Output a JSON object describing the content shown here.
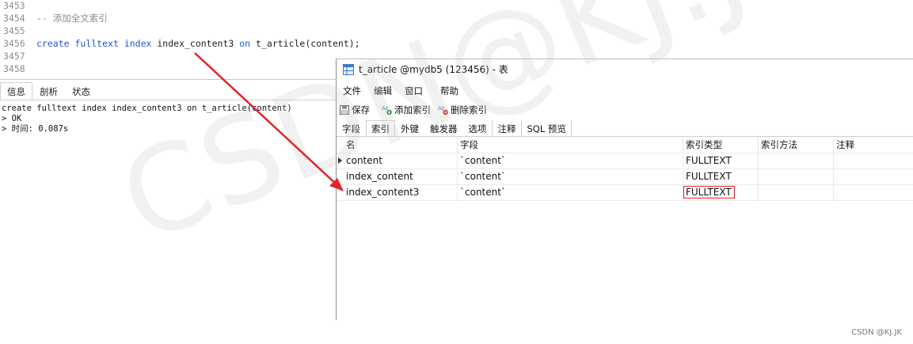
{
  "editor": {
    "lines": [
      {
        "num": "3453",
        "text": ""
      },
      {
        "num": "3454",
        "comment": "-- 添加全文索引"
      },
      {
        "num": "3455",
        "text": ""
      },
      {
        "num": "3456",
        "sql": true
      },
      {
        "num": "3457",
        "text": ""
      },
      {
        "num": "3458",
        "text": ""
      }
    ],
    "sql_tokens": {
      "create": "create",
      "fulltext": "fulltext",
      "index": "index",
      "name": "index_content3",
      "on": "on",
      "target": "t_article(content);"
    }
  },
  "result": {
    "tabs": [
      "信息",
      "剖析",
      "状态"
    ],
    "active_tab": "信息",
    "output": [
      "create fulltext index index_content3 on t_article(content)",
      "> OK",
      "> 时间: 0.087s"
    ]
  },
  "table_window": {
    "title": "t_article @mydb5 (123456) - 表",
    "menu": [
      "文件",
      "编辑",
      "窗口",
      "帮助"
    ],
    "toolbar": {
      "save": "保存",
      "add_index": "添加索引",
      "delete_index": "删除索引"
    },
    "tabs": [
      "字段",
      "索引",
      "外键",
      "触发器",
      "选项",
      "注释",
      "SQL 预览"
    ],
    "active_tab": "索引",
    "columns": [
      "名",
      "字段",
      "索引类型",
      "索引方法",
      "注释"
    ],
    "rows": [
      {
        "name": "content",
        "field": "`content`",
        "type": "FULLTEXT",
        "method": "",
        "comment": ""
      },
      {
        "name": "index_content",
        "field": "`content`",
        "type": "FULLTEXT",
        "method": "",
        "comment": ""
      },
      {
        "name": "index_content3",
        "field": "`content`",
        "type": "FULLTEXT",
        "method": "",
        "comment": ""
      }
    ]
  },
  "watermark": "CSDN@KJ.JK",
  "credit": "CSDN @KJ.JK",
  "colors": {
    "keyword": "#1f57d0",
    "arrow": "#e0242b",
    "highlight_box": "#e0242b"
  }
}
